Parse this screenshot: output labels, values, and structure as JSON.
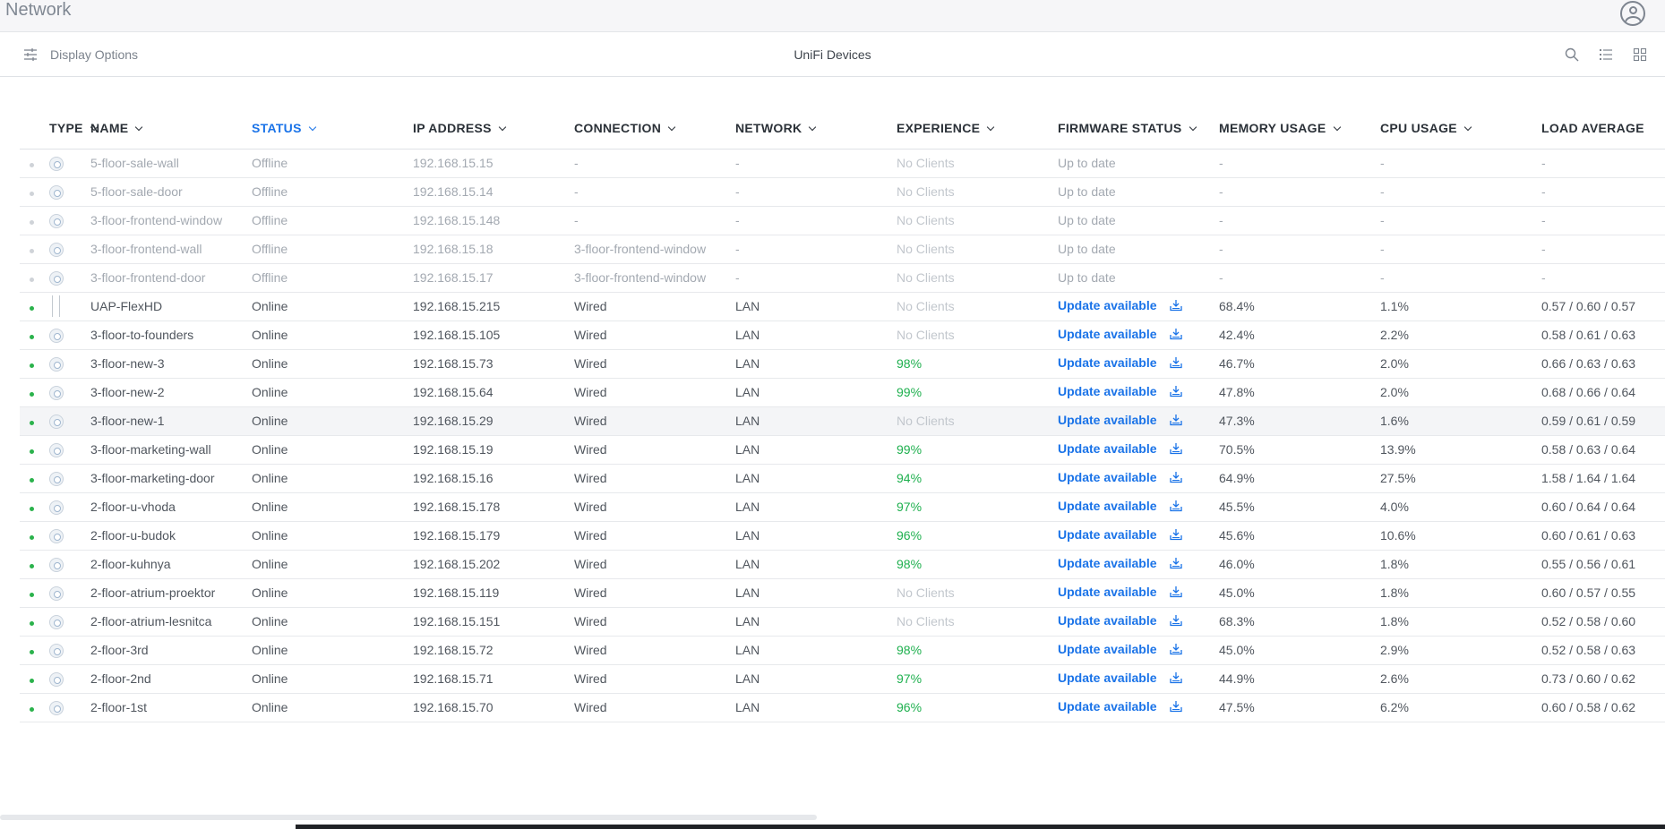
{
  "app": {
    "title": "Network"
  },
  "toolbar": {
    "display_options_label": "Display Options",
    "title": "UniFi Devices"
  },
  "columns": [
    "TYPE",
    "NAME",
    "STATUS",
    "IP ADDRESS",
    "CONNECTION",
    "NETWORK",
    "EXPERIENCE",
    "FIRMWARE STATUS",
    "MEMORY USAGE",
    "CPU USAGE",
    "LOAD AVERAGE"
  ],
  "sort_column": "STATUS",
  "colors": {
    "accent": "#1a73e8",
    "online": "#2bb24c",
    "good_experience": "#1fb04f"
  },
  "devices": [
    {
      "icon": "access-point-icon",
      "name": "5-floor-sale-wall",
      "status": "Offline",
      "ip": "192.168.15.15",
      "connection": "-",
      "network": "-",
      "experience": "No Clients",
      "firmware": "Up to date",
      "memory": "-",
      "cpu": "-",
      "load": "-"
    },
    {
      "icon": "access-point-icon",
      "name": "5-floor-sale-door",
      "status": "Offline",
      "ip": "192.168.15.14",
      "connection": "-",
      "network": "-",
      "experience": "No Clients",
      "firmware": "Up to date",
      "memory": "-",
      "cpu": "-",
      "load": "-"
    },
    {
      "icon": "access-point-icon",
      "name": "3-floor-frontend-window",
      "status": "Offline",
      "ip": "192.168.15.148",
      "connection": "-",
      "network": "-",
      "experience": "No Clients",
      "firmware": "Up to date",
      "memory": "-",
      "cpu": "-",
      "load": "-"
    },
    {
      "icon": "access-point-icon",
      "name": "3-floor-frontend-wall",
      "status": "Offline",
      "ip": "192.168.15.18",
      "connection": "3-floor-frontend-window",
      "network": "-",
      "experience": "No Clients",
      "firmware": "Up to date",
      "memory": "-",
      "cpu": "-",
      "load": "-"
    },
    {
      "icon": "access-point-icon",
      "name": "3-floor-frontend-door",
      "status": "Offline",
      "ip": "192.168.15.17",
      "connection": "3-floor-frontend-window",
      "network": "-",
      "experience": "No Clients",
      "firmware": "Up to date",
      "memory": "-",
      "cpu": "-",
      "load": "-"
    },
    {
      "icon": "flexhd-icon",
      "name": "UAP-FlexHD",
      "status": "Online",
      "ip": "192.168.15.215",
      "connection": "Wired",
      "network": "LAN",
      "experience": "No Clients",
      "firmware": "Update available",
      "memory": "68.4%",
      "cpu": "1.1%",
      "load": "0.57 / 0.60 / 0.57"
    },
    {
      "icon": "access-point-icon",
      "name": "3-floor-to-founders",
      "status": "Online",
      "ip": "192.168.15.105",
      "connection": "Wired",
      "network": "LAN",
      "experience": "No Clients",
      "firmware": "Update available",
      "memory": "42.4%",
      "cpu": "2.2%",
      "load": "0.58 / 0.61 / 0.63"
    },
    {
      "icon": "access-point-icon",
      "name": "3-floor-new-3",
      "status": "Online",
      "ip": "192.168.15.73",
      "connection": "Wired",
      "network": "LAN",
      "experience": "98%",
      "firmware": "Update available",
      "memory": "46.7%",
      "cpu": "2.0%",
      "load": "0.66 / 0.63 / 0.63"
    },
    {
      "icon": "access-point-icon",
      "name": "3-floor-new-2",
      "status": "Online",
      "ip": "192.168.15.64",
      "connection": "Wired",
      "network": "LAN",
      "experience": "99%",
      "firmware": "Update available",
      "memory": "47.8%",
      "cpu": "2.0%",
      "load": "0.68 / 0.66 / 0.64"
    },
    {
      "icon": "access-point-icon",
      "name": "3-floor-new-1",
      "status": "Online",
      "ip": "192.168.15.29",
      "connection": "Wired",
      "network": "LAN",
      "experience": "No Clients",
      "firmware": "Update available",
      "memory": "47.3%",
      "cpu": "1.6%",
      "load": "0.59 / 0.61 / 0.59"
    },
    {
      "icon": "access-point-icon",
      "name": "3-floor-marketing-wall",
      "status": "Online",
      "ip": "192.168.15.19",
      "connection": "Wired",
      "network": "LAN",
      "experience": "99%",
      "firmware": "Update available",
      "memory": "70.5%",
      "cpu": "13.9%",
      "load": "0.58 / 0.63 / 0.64"
    },
    {
      "icon": "access-point-icon",
      "name": "3-floor-marketing-door",
      "status": "Online",
      "ip": "192.168.15.16",
      "connection": "Wired",
      "network": "LAN",
      "experience": "94%",
      "firmware": "Update available",
      "memory": "64.9%",
      "cpu": "27.5%",
      "load": "1.58 / 1.64 / 1.64"
    },
    {
      "icon": "access-point-icon",
      "name": "2-floor-u-vhoda",
      "status": "Online",
      "ip": "192.168.15.178",
      "connection": "Wired",
      "network": "LAN",
      "experience": "97%",
      "firmware": "Update available",
      "memory": "45.5%",
      "cpu": "4.0%",
      "load": "0.60 / 0.64 / 0.64"
    },
    {
      "icon": "access-point-icon",
      "name": "2-floor-u-budok",
      "status": "Online",
      "ip": "192.168.15.179",
      "connection": "Wired",
      "network": "LAN",
      "experience": "96%",
      "firmware": "Update available",
      "memory": "45.6%",
      "cpu": "10.6%",
      "load": "0.60 / 0.61 / 0.63"
    },
    {
      "icon": "access-point-icon",
      "name": "2-floor-kuhnya",
      "status": "Online",
      "ip": "192.168.15.202",
      "connection": "Wired",
      "network": "LAN",
      "experience": "98%",
      "firmware": "Update available",
      "memory": "46.0%",
      "cpu": "1.8%",
      "load": "0.55 / 0.56 / 0.61"
    },
    {
      "icon": "access-point-icon",
      "name": "2-floor-atrium-proektor",
      "status": "Online",
      "ip": "192.168.15.119",
      "connection": "Wired",
      "network": "LAN",
      "experience": "No Clients",
      "firmware": "Update available",
      "memory": "45.0%",
      "cpu": "1.8%",
      "load": "0.60 / 0.57 / 0.55"
    },
    {
      "icon": "access-point-icon",
      "name": "2-floor-atrium-lesnitca",
      "status": "Online",
      "ip": "192.168.15.151",
      "connection": "Wired",
      "network": "LAN",
      "experience": "No Clients",
      "firmware": "Update available",
      "memory": "68.3%",
      "cpu": "1.8%",
      "load": "0.52 / 0.58 / 0.60"
    },
    {
      "icon": "access-point-icon",
      "name": "2-floor-3rd",
      "status": "Online",
      "ip": "192.168.15.72",
      "connection": "Wired",
      "network": "LAN",
      "experience": "98%",
      "firmware": "Update available",
      "memory": "45.0%",
      "cpu": "2.9%",
      "load": "0.52 / 0.58 / 0.63"
    },
    {
      "icon": "access-point-icon",
      "name": "2-floor-2nd",
      "status": "Online",
      "ip": "192.168.15.71",
      "connection": "Wired",
      "network": "LAN",
      "experience": "97%",
      "firmware": "Update available",
      "memory": "44.9%",
      "cpu": "2.6%",
      "load": "0.73 / 0.60 / 0.62"
    },
    {
      "icon": "access-point-icon",
      "name": "2-floor-1st",
      "status": "Online",
      "ip": "192.168.15.70",
      "connection": "Wired",
      "network": "LAN",
      "experience": "96%",
      "firmware": "Update available",
      "memory": "47.5%",
      "cpu": "6.2%",
      "load": "0.60 / 0.58 / 0.62"
    }
  ]
}
